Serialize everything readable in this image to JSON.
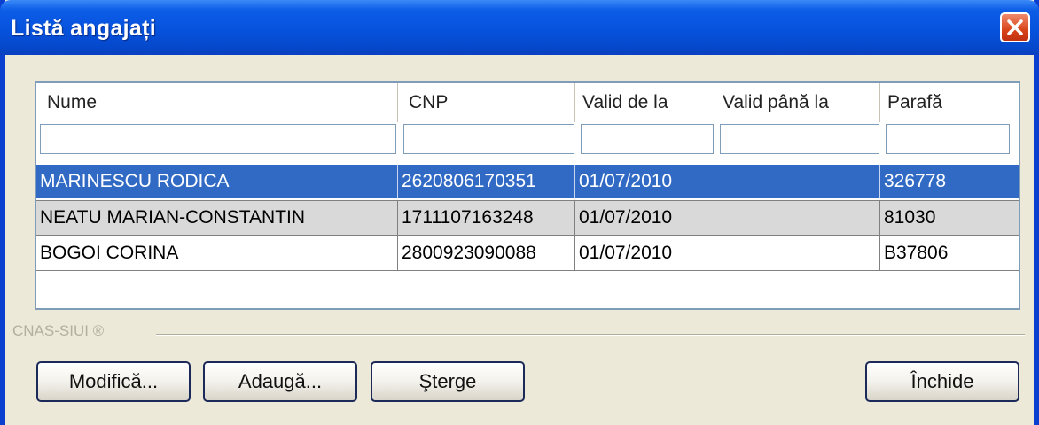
{
  "window": {
    "title": "Listă angajați",
    "close_glyph": "✕"
  },
  "table": {
    "columns": [
      "Nume",
      "CNP",
      "Valid de la",
      "Valid până la",
      "Parafă"
    ],
    "filters": [
      "",
      "",
      "",
      "",
      ""
    ],
    "rows": [
      [
        "MARINESCU RODICA",
        "2620806170351",
        "01/07/2010",
        "",
        "326778"
      ],
      [
        "NEATU MARIAN-CONSTANTIN",
        "1711107163248",
        "01/07/2010",
        "",
        "81030"
      ],
      [
        "BOGOI CORINA",
        "2800923090088",
        "01/07/2010",
        "",
        "B37806"
      ]
    ]
  },
  "group_label": "CNAS-SIUI ®",
  "buttons": {
    "modify": "Modifică...",
    "add": "Adaugă...",
    "delete": "Şterge",
    "close": "Închide"
  },
  "colors": {
    "selection": "#316ac5",
    "titlebar": "#0652dd",
    "alt_row": "#d9d9d9"
  }
}
